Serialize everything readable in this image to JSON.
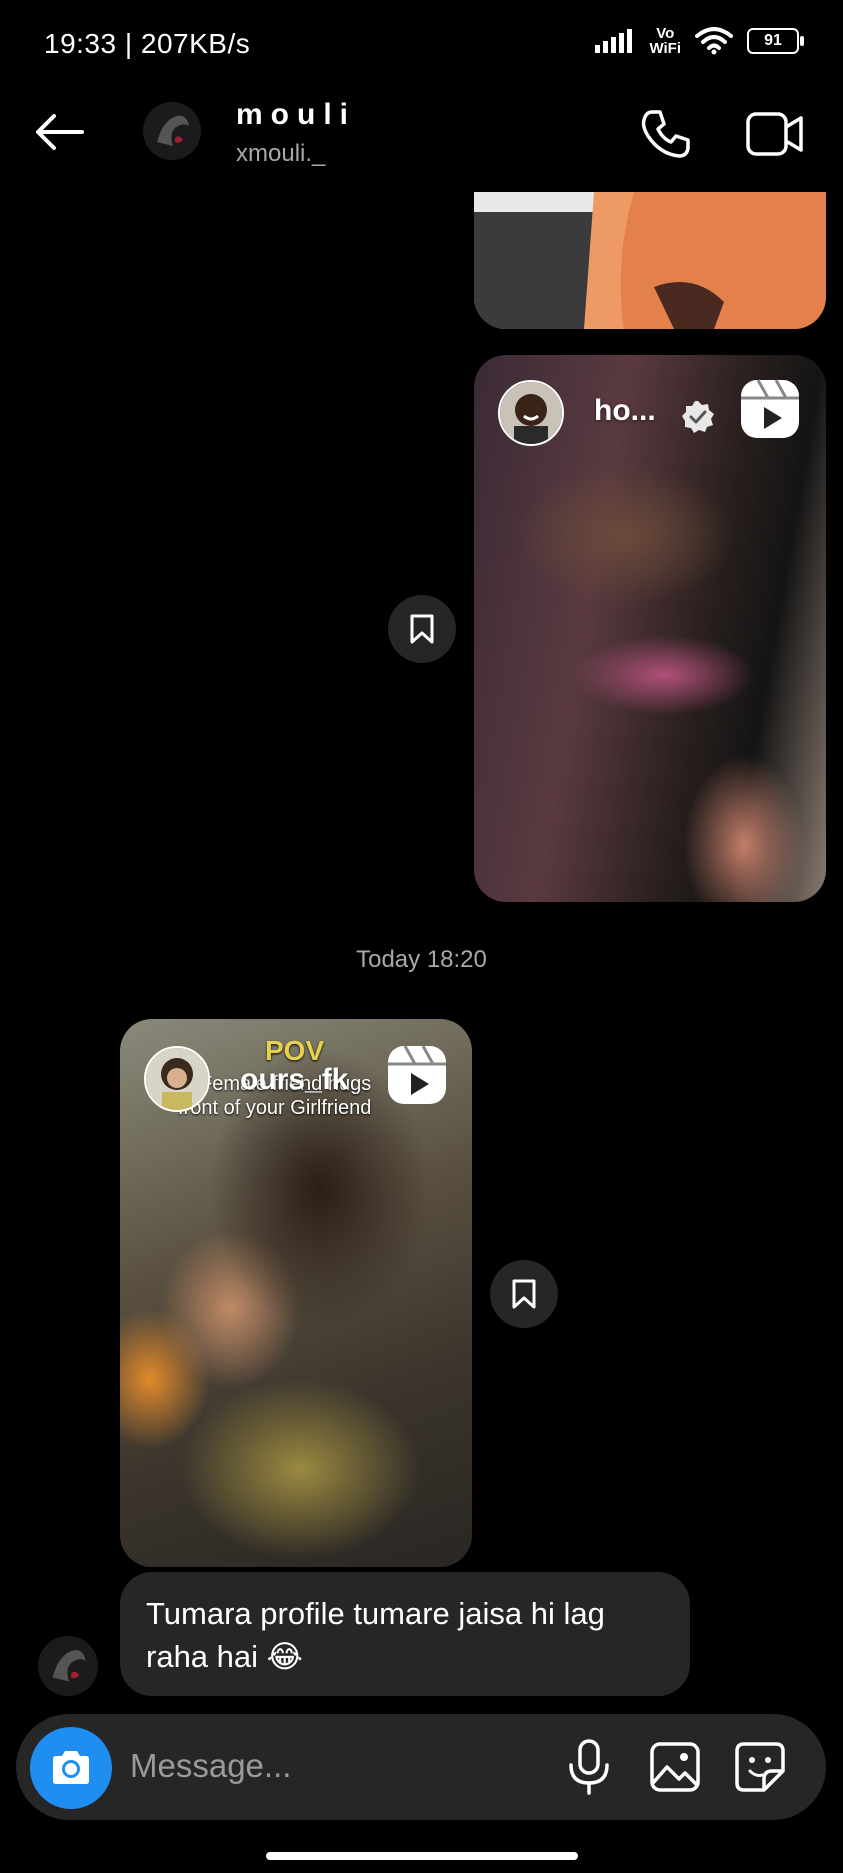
{
  "status_bar": {
    "time_speed": "19:33 | 207KB/s",
    "vowifi_top": "Vo",
    "vowifi_bottom": "WiFi",
    "battery": "91"
  },
  "header": {
    "name": "mouli",
    "username": "xmouli._"
  },
  "messages": {
    "reel1_user": "ho...",
    "timestamp": "Today 18:20",
    "reel2_user": "ours_fk",
    "reel2_pov": "POV",
    "reel2_caption_line1": "Female friend hugs",
    "reel2_caption_line2": "front of your Girlfriend",
    "text_message": "Tumara profile tumare jaisa hi lag raha hai 😂"
  },
  "composer": {
    "placeholder": "Message..."
  },
  "icons": {
    "back": "arrow-left-icon",
    "call": "phone-icon",
    "video": "video-camera-icon",
    "save": "bookmark-icon",
    "reels": "reels-icon",
    "verified": "verified-badge-icon",
    "camera": "camera-icon",
    "mic": "microphone-icon",
    "gallery": "gallery-icon",
    "sticker": "sticker-icon"
  },
  "colors": {
    "background": "#000000",
    "bubble": "#262626",
    "accent": "#1f8ef1",
    "secondary_text": "#a8a8a8"
  }
}
